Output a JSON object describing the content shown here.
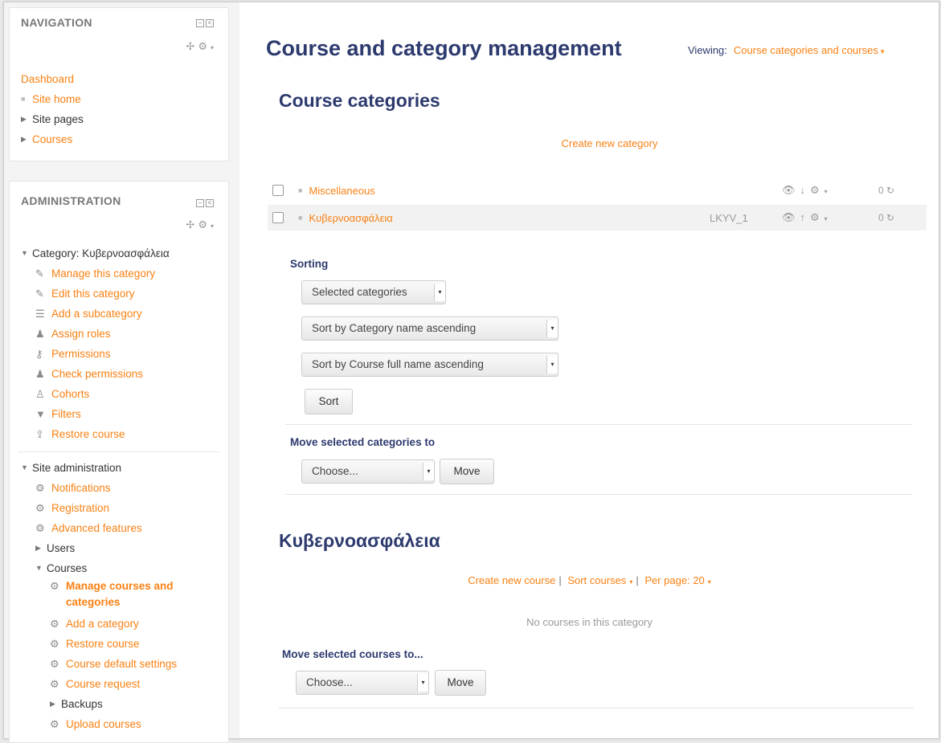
{
  "navigation": {
    "title": "NAVIGATION",
    "dashboard": "Dashboard",
    "items": [
      {
        "label": "Site home"
      },
      {
        "label": "Site pages"
      },
      {
        "label": "Courses"
      }
    ]
  },
  "administration": {
    "title": "ADMINISTRATION",
    "category_node": "Category: Κυβερνοασφάλεια",
    "category_items": [
      {
        "label": "Manage this category",
        "icon": "pencil-icon"
      },
      {
        "label": "Edit this category",
        "icon": "pencil-icon"
      },
      {
        "label": "Add a subcategory",
        "icon": "list-icon"
      },
      {
        "label": "Assign roles",
        "icon": "user-icon"
      },
      {
        "label": "Permissions",
        "icon": "key-icon"
      },
      {
        "label": "Check permissions",
        "icon": "user-check-icon"
      },
      {
        "label": "Cohorts",
        "icon": "users-icon"
      },
      {
        "label": "Filters",
        "icon": "filter-icon"
      },
      {
        "label": "Restore course",
        "icon": "upload-icon"
      }
    ],
    "site_admin": "Site administration",
    "site_items": [
      {
        "label": "Notifications"
      },
      {
        "label": "Registration"
      },
      {
        "label": "Advanced features"
      }
    ],
    "users": "Users",
    "courses": "Courses",
    "course_items": [
      {
        "label": "Manage courses and",
        "label2": "categories"
      },
      {
        "label": "Add a category"
      },
      {
        "label": "Restore course"
      },
      {
        "label": "Course default settings"
      },
      {
        "label": "Course request"
      }
    ],
    "backups": "Backups",
    "upload_courses": "Upload courses"
  },
  "main": {
    "title": "Course and category management",
    "viewing_label": "Viewing:",
    "viewing_value": "Course categories and courses",
    "categories_heading": "Course categories",
    "create_category": "Create new category",
    "categories": [
      {
        "name": "Miscellaneous",
        "idnumber": "",
        "count": "0"
      },
      {
        "name": "Κυβερνοασφάλεια",
        "idnumber": "LKYV_1",
        "count": "0"
      }
    ],
    "sorting_label": "Sorting",
    "sort_scope": "Selected categories",
    "sort_categories": "Sort by Category name ascending",
    "sort_courses": "Sort by Course full name ascending",
    "sort_button": "Sort",
    "move_categories_label": "Move selected categories to",
    "move_categories_select": "Choose...",
    "move_button": "Move",
    "category_section_title": "Κυβερνοασφάλεια",
    "create_course": "Create new course",
    "sort_courses_link": "Sort courses",
    "per_page": "Per page: 20",
    "no_courses": "No courses in this category",
    "move_courses_label": "Move selected courses to...",
    "move_courses_select": "Choose...",
    "move_courses_button": "Move"
  },
  "colors": {
    "link": "#f98012",
    "heading": "#2d3a6e"
  }
}
